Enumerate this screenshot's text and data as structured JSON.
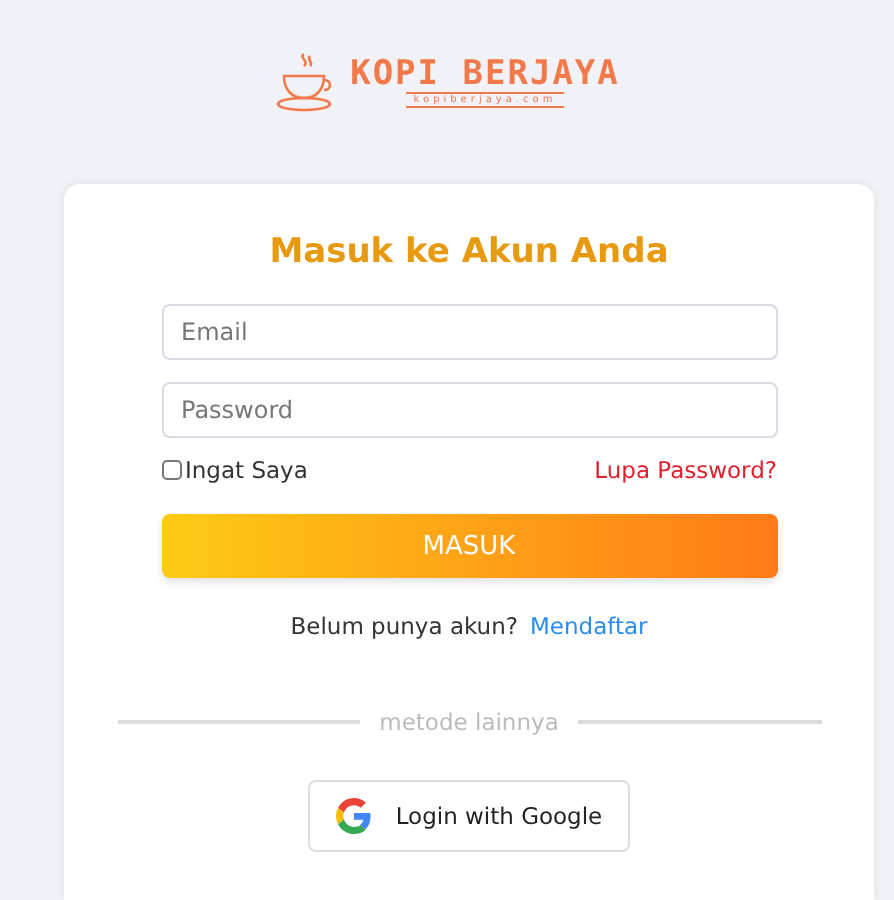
{
  "logo": {
    "name": "KOPI BERJAYA",
    "site": "kopiberjaya.com"
  },
  "title": "Masuk ke Akun Anda",
  "fields": [
    {
      "placeholder": "Email"
    },
    {
      "placeholder": "Password"
    }
  ],
  "remember": {
    "label": "Ingat Saya",
    "checked": false
  },
  "forgot_link": "Lupa Password?",
  "submit": "MASUK",
  "signup": {
    "text": "Belum punya akun?",
    "link": "Mendaftar"
  },
  "divider": "metode lainnya",
  "google_button": "Login with Google"
}
